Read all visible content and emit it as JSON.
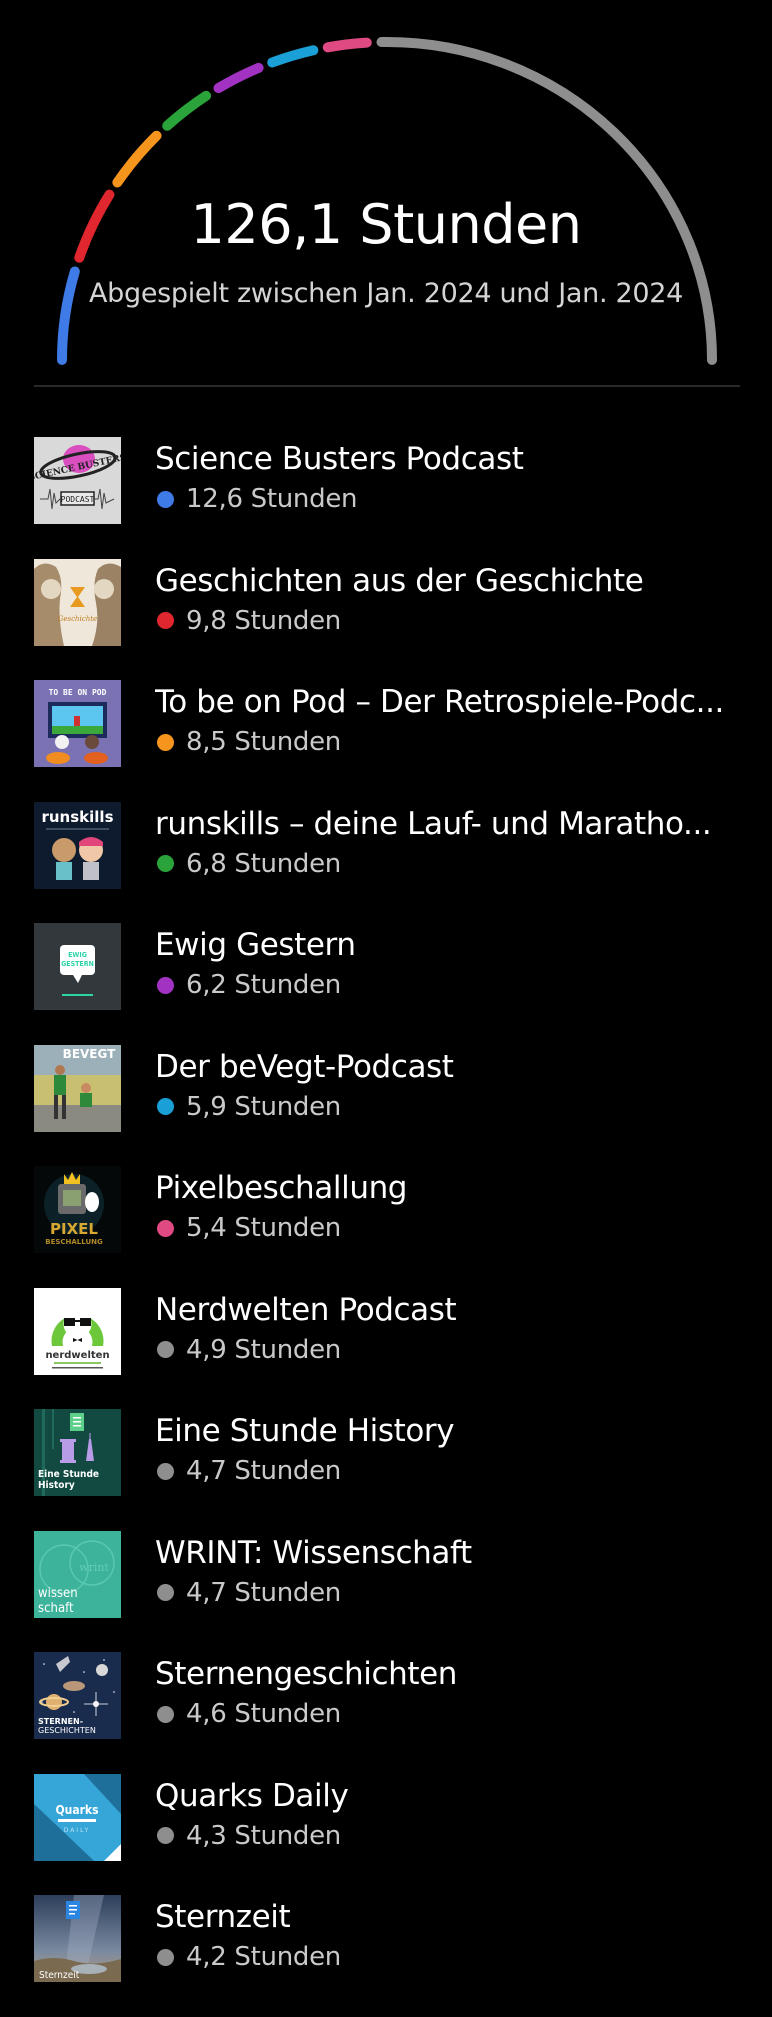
{
  "summary": {
    "total": "126,1 Stunden",
    "total_hours": 126.1,
    "range": "Abgespielt zwischen Jan. 2024 und Jan. 2024"
  },
  "colors": {
    "other": "#8e8e8e",
    "divider": "#2a2a2a"
  },
  "podcasts": [
    {
      "title": "Science Busters Podcast",
      "duration": "12,6 Stunden",
      "hours": 12.6,
      "color": "#3f7be6",
      "cover": "science-busters-cover"
    },
    {
      "title": "Geschichten aus der Geschichte",
      "duration": "9,8 Stunden",
      "hours": 9.8,
      "color": "#e0262e",
      "cover": "geschichten-cover"
    },
    {
      "title": "To be on Pod – Der Retrospiele-Podc...",
      "duration": "8,5 Stunden",
      "hours": 8.5,
      "color": "#f6951e",
      "cover": "to-be-on-pod-cover"
    },
    {
      "title": "runskills – deine Lauf- und Maratho...",
      "duration": "6,8 Stunden",
      "hours": 6.8,
      "color": "#2aa33a",
      "cover": "runskills-cover"
    },
    {
      "title": "Ewig Gestern",
      "duration": "6,2 Stunden",
      "hours": 6.2,
      "color": "#a233c2",
      "cover": "ewig-gestern-cover"
    },
    {
      "title": "Der beVegt-Podcast",
      "duration": "5,9 Stunden",
      "hours": 5.9,
      "color": "#1aa0d6",
      "cover": "bevegt-cover"
    },
    {
      "title": "Pixelbeschallung",
      "duration": "5,4 Stunden",
      "hours": 5.4,
      "color": "#e04a83",
      "cover": "pixelbeschallung-cover"
    },
    {
      "title": "Nerdwelten Podcast",
      "duration": "4,9 Stunden",
      "hours": 4.9,
      "color": "#8e8e8e",
      "cover": "nerdwelten-cover"
    },
    {
      "title": "Eine Stunde History",
      "duration": "4,7 Stunden",
      "hours": 4.7,
      "color": "#8e8e8e",
      "cover": "eine-stunde-history-cover"
    },
    {
      "title": "WRINT: Wissenschaft",
      "duration": "4,7 Stunden",
      "hours": 4.7,
      "color": "#8e8e8e",
      "cover": "wrint-cover"
    },
    {
      "title": "Sternengeschichten",
      "duration": "4,6 Stunden",
      "hours": 4.6,
      "color": "#8e8e8e",
      "cover": "sternengeschichten-cover"
    },
    {
      "title": "Quarks Daily",
      "duration": "4,3 Stunden",
      "hours": 4.3,
      "color": "#8e8e8e",
      "cover": "quarks-daily-cover"
    },
    {
      "title": "Sternzeit",
      "duration": "4,2 Stunden",
      "hours": 4.2,
      "color": "#8e8e8e",
      "cover": "sternzeit-cover"
    }
  ]
}
